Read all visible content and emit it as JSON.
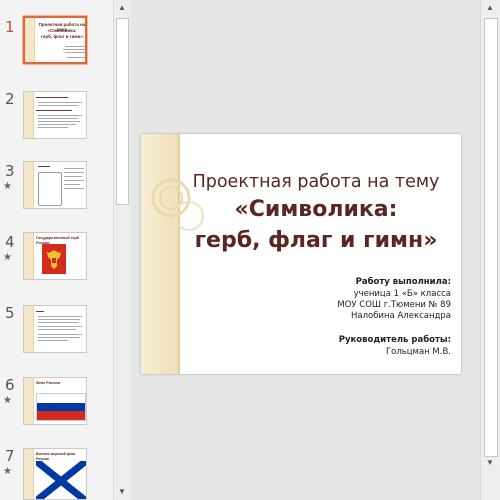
{
  "thumbnails": [
    {
      "number": "1",
      "star": "",
      "title_lines": [
        "Проектная работа на тему",
        "«Символика:",
        "герб, флаг и гимн»"
      ]
    },
    {
      "number": "2",
      "star": ""
    },
    {
      "number": "3",
      "star": "★"
    },
    {
      "number": "4",
      "star": "★",
      "title": "Государственный герб России"
    },
    {
      "number": "5",
      "star": ""
    },
    {
      "number": "6",
      "star": "★",
      "title": "Флаг России"
    },
    {
      "number": "7",
      "star": "★",
      "title": "Военно-морской флаг России"
    }
  ],
  "slide": {
    "title_line1": "Проектная работа на тему",
    "title_line2": "«Символика:",
    "title_line3": "герб, флаг и гимн»",
    "author_label": "Работу выполнила:",
    "author_line1": "ученица 1 «Б» класса",
    "author_line2": "МОУ СОШ г.Тюмени № 89",
    "author_line3": "Налобина Александра",
    "supervisor_label": "Руководитель работы:",
    "supervisor_name": "Гольцман М.В."
  },
  "colors": {
    "accent": "#e0663c",
    "title": "#5b2520",
    "band": "#f3e7c7",
    "flag_white": "#ffffff",
    "flag_blue": "#0039a6",
    "flag_red": "#d52b1e"
  },
  "icons": {
    "scroll_up": "▲",
    "scroll_down": "▼"
  }
}
